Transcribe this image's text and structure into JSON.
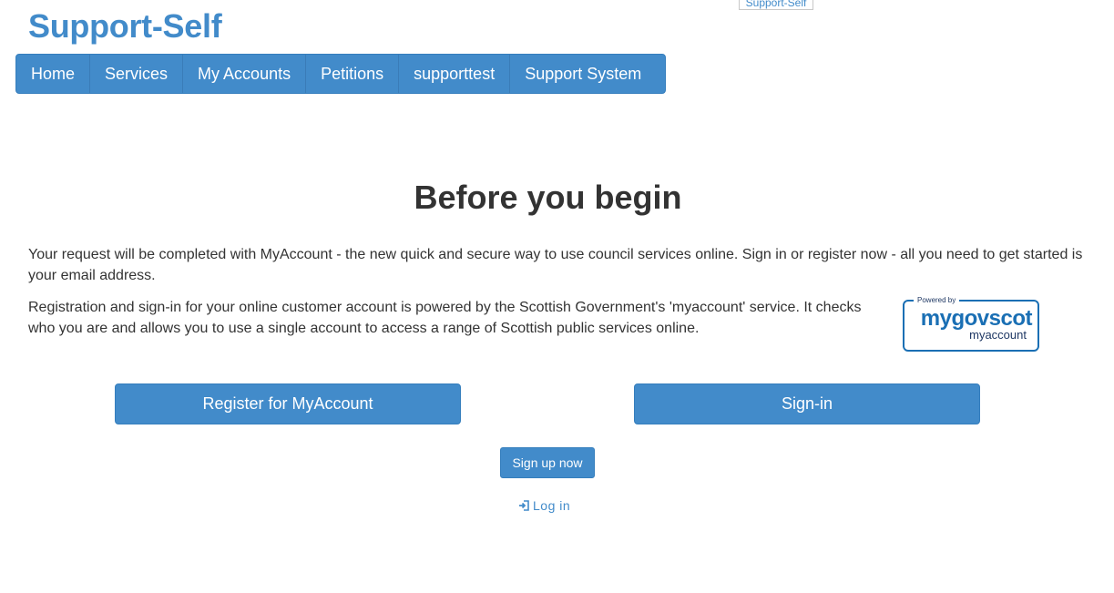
{
  "site": {
    "title": "Support-Self",
    "corner_logo_alt": "Support-Self"
  },
  "nav": {
    "items": [
      {
        "label": "Home"
      },
      {
        "label": "Services"
      },
      {
        "label": "My Accounts"
      },
      {
        "label": "Petitions"
      },
      {
        "label": "supporttest"
      },
      {
        "label": "Support System"
      }
    ]
  },
  "main": {
    "heading": "Before you begin",
    "paragraph1": "Your request will be completed with MyAccount - the new quick and secure way to use council services online. Sign in or register now - all you need to get started is your email address.",
    "paragraph2": "Registration and sign-in for your online customer account is powered by the Scottish Government's 'myaccount' service. It checks who you are and allows you to use a single account to access a range of Scottish public services online.",
    "badge": {
      "powered_by": "Powered by",
      "brand": "mygovscot",
      "sub": "myaccount"
    },
    "register_button": "Register for MyAccount",
    "signin_button": "Sign-in",
    "signup_button": "Sign up now",
    "login_link": "Log in"
  },
  "colors": {
    "primary": "#428bca",
    "text": "#333333",
    "badge": "#1a6fb4"
  }
}
